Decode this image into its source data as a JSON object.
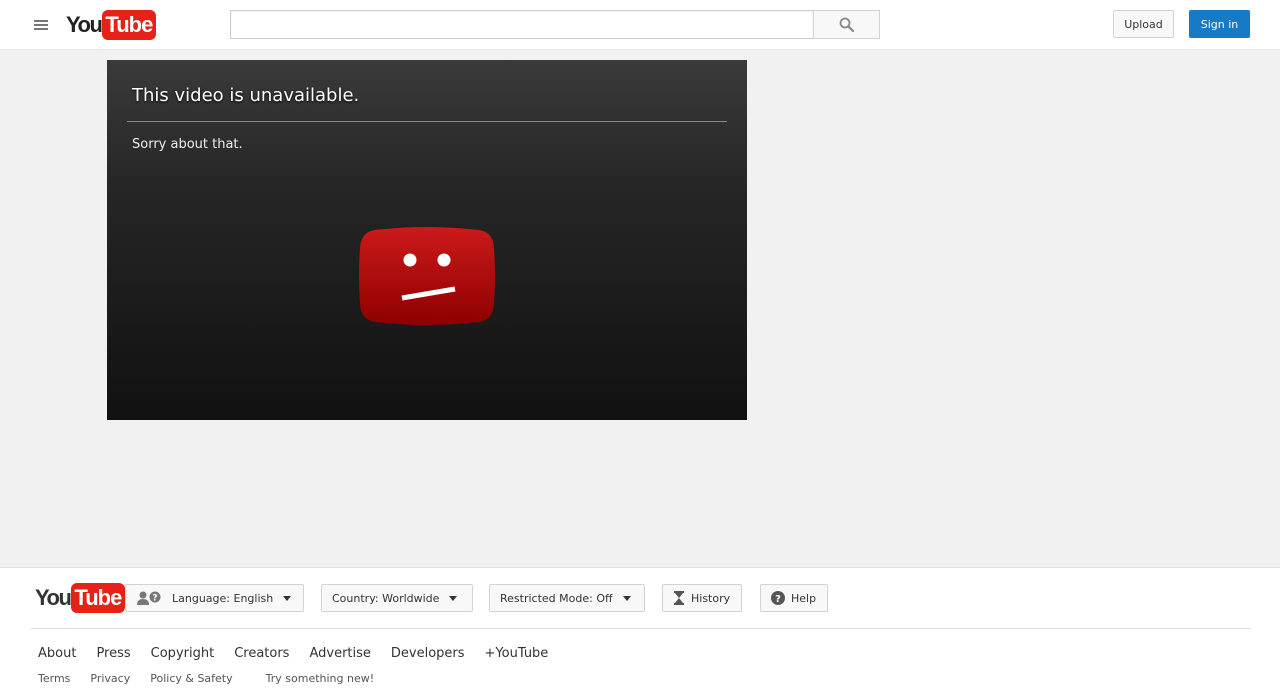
{
  "header": {
    "logo_you": "You",
    "logo_tube": "Tube",
    "search": {
      "value": "",
      "placeholder": ""
    },
    "upload_label": "Upload",
    "signin_label": "Sign in"
  },
  "player": {
    "title": "This video is unavailable.",
    "subtitle": "Sorry about that."
  },
  "footer": {
    "logo_you": "You",
    "logo_tube": "Tube",
    "language_label": "Language: English",
    "country_label": "Country: Worldwide",
    "restricted_label": "Restricted Mode: Off",
    "history_label": "History",
    "help_label": "Help",
    "primary_links": [
      "About",
      "Press",
      "Copyright",
      "Creators",
      "Advertise",
      "Developers",
      "+YouTube"
    ],
    "secondary_links": [
      "Terms",
      "Privacy",
      "Policy & Safety",
      "Try something new!"
    ]
  },
  "colors": {
    "brand_red": "#e62117",
    "signin_blue": "#167ac6",
    "sad_icon_red": "#b30000"
  },
  "icons": {
    "menu": "hamburger-menu-icon",
    "search": "magnifier-icon",
    "sad_face": "sad-video-icon",
    "language": "people-question-icon",
    "history": "hourglass-icon",
    "help": "question-circle-icon"
  }
}
